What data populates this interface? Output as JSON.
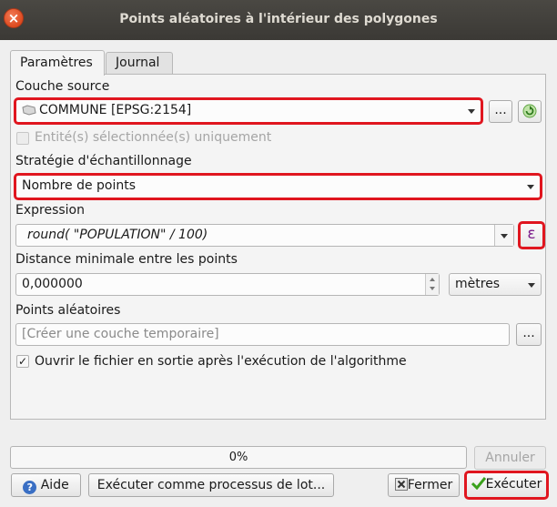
{
  "window": {
    "title": "Points aléatoires à l'intérieur des polygones",
    "close_glyph": "×"
  },
  "tabs": [
    {
      "label": "Paramètres"
    },
    {
      "label": "Journal"
    }
  ],
  "source_layer": {
    "label": "Couche source",
    "value": "COMMUNE [EPSG:2154]",
    "browse_label": "..."
  },
  "selected_only": {
    "label": "Entité(s) sélectionnée(s) uniquement",
    "checked": false
  },
  "strategy": {
    "label": "Stratégie d'échantillonnage",
    "value": "Nombre de points"
  },
  "expression": {
    "label": "Expression",
    "value": "round( \"POPULATION\"  / 100)",
    "button_glyph": "ε"
  },
  "min_distance": {
    "label": "Distance minimale entre les points",
    "value": "0,000000",
    "unit": "mètres"
  },
  "output": {
    "label": "Points aléatoires",
    "placeholder": "[Créer une couche temporaire]",
    "browse_label": "..."
  },
  "open_output": {
    "label": "Ouvrir le fichier en sortie après l'exécution de l'algorithme",
    "checked": true,
    "check_glyph": "✓"
  },
  "progress": {
    "text": "0%",
    "value": 0
  },
  "buttons": {
    "cancel": "Annuler",
    "help": "Aide",
    "help_glyph": "?",
    "batch": "Exécuter comme processus de lot...",
    "close": "Fermer",
    "run": "Exécuter"
  },
  "colors": {
    "highlight": "#e0161f",
    "titlebar": "#3f3d39"
  }
}
